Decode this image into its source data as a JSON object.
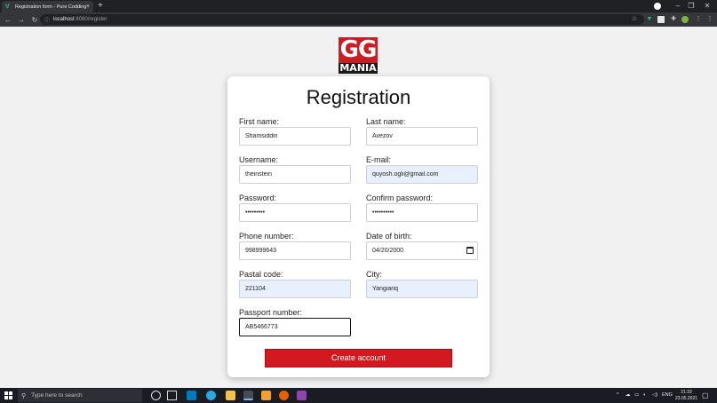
{
  "browser": {
    "tab_title": "Registration form - Pure Codding",
    "tab_close": "×",
    "new_tab": "+",
    "window_controls": {
      "minimize": "–",
      "maximize": "❐",
      "close": "✕"
    },
    "nav": {
      "back": "←",
      "forward": "→",
      "reload": "↻"
    },
    "info_icon": "ⓘ",
    "url_host": "localhost",
    "url_path": ":8080/register",
    "icons": [
      "star-icon",
      "vue-devtools-icon",
      "extension-icon",
      "extensions-puzzle-icon",
      "profile-icon",
      "menu-icon"
    ]
  },
  "logo": {
    "top_text": "GG",
    "bottom_text": "MANIA"
  },
  "form": {
    "title": "Registration",
    "fields": {
      "first_name": {
        "label": "First name:",
        "value": "Shamsiddin"
      },
      "last_name": {
        "label": "Last name:",
        "value": "Avezov"
      },
      "username": {
        "label": "Username:",
        "value": "theinstein"
      },
      "email": {
        "label": "E-mail:",
        "value": "quyosh.ogli@gmail.com"
      },
      "password": {
        "label": "Password:",
        "value": "•••••••••"
      },
      "confirm_password": {
        "label": "Confirm password:",
        "value": "••••••••••"
      },
      "phone": {
        "label": "Phone number:",
        "value": "998999643"
      },
      "dob": {
        "label": "Date of birth:",
        "value": "04/20/2000"
      },
      "postal": {
        "label": "Pastal code:",
        "value": "221104"
      },
      "city": {
        "label": "City:",
        "value": "Yangiariq"
      },
      "passport": {
        "label": "Passport number:",
        "value": "AB5466773"
      }
    },
    "submit_label": "Create account"
  },
  "taskbar": {
    "search_placeholder": "Type here to search",
    "search_icon": "⚲",
    "language": "ENG",
    "time": "21:33",
    "date": "23.05.2021"
  },
  "colors": {
    "accent_red": "#d2191f",
    "autofill_blue": "#e8f0fe",
    "page_bg": "#f1f1f1"
  }
}
